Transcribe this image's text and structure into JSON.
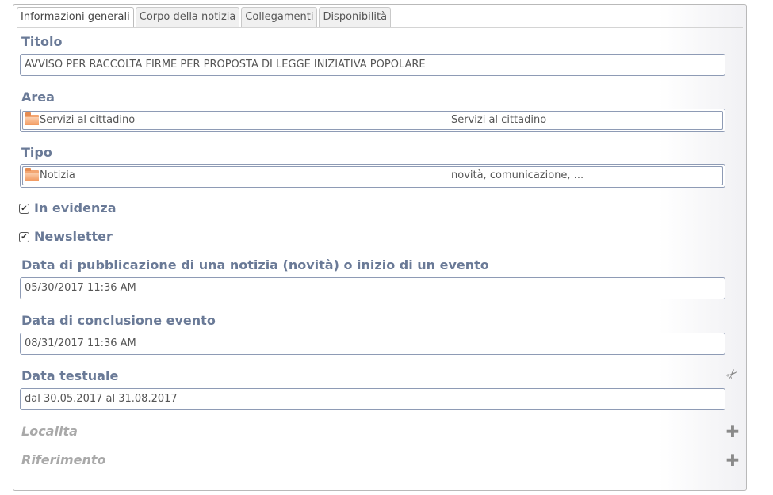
{
  "tabs": [
    {
      "label": "Informazioni generali",
      "active": true
    },
    {
      "label": "Corpo della notizia",
      "active": false
    },
    {
      "label": "Collegamenti",
      "active": false
    },
    {
      "label": "Disponibilità",
      "active": false
    }
  ],
  "form": {
    "titolo": {
      "label": "Titolo",
      "value": "AVVISO PER RACCOLTA FIRME PER PROPOSTA DI LEGGE INIZIATIVA POPOLARE"
    },
    "area": {
      "label": "Area",
      "value": "Servizi al cittadino",
      "description": "Servizi al cittadino",
      "icon": "folder-icon"
    },
    "tipo": {
      "label": "Tipo",
      "value": "Notizia",
      "description": "novità, comunicazione, ...",
      "icon": "folder-icon"
    },
    "in_evidenza": {
      "label": "In evidenza",
      "checked": true
    },
    "newsletter": {
      "label": "Newsletter",
      "checked": true
    },
    "data_pubblicazione": {
      "label": "Data di pubblicazione di una notizia (novità) o inizio di un evento",
      "value": "05/30/2017 11:36 AM"
    },
    "data_conclusione": {
      "label": "Data di conclusione evento",
      "value": "08/31/2017 11:36 AM"
    },
    "data_testuale": {
      "label": "Data testuale",
      "value": "dal 30.05.2017 al 31.08.2017",
      "icon": "scissors-icon"
    },
    "localita": {
      "label": "Localita",
      "icon": "plus-icon"
    },
    "riferimento": {
      "label": "Riferimento",
      "icon": "plus-icon"
    }
  },
  "glyphs": {
    "check": "✔",
    "scissors": "✂",
    "plus": "✚"
  },
  "colors": {
    "label": "#6a7a97",
    "muted_label": "#a9a9a9",
    "input_border": "#8e9bb5",
    "folder": "#f3a571"
  }
}
